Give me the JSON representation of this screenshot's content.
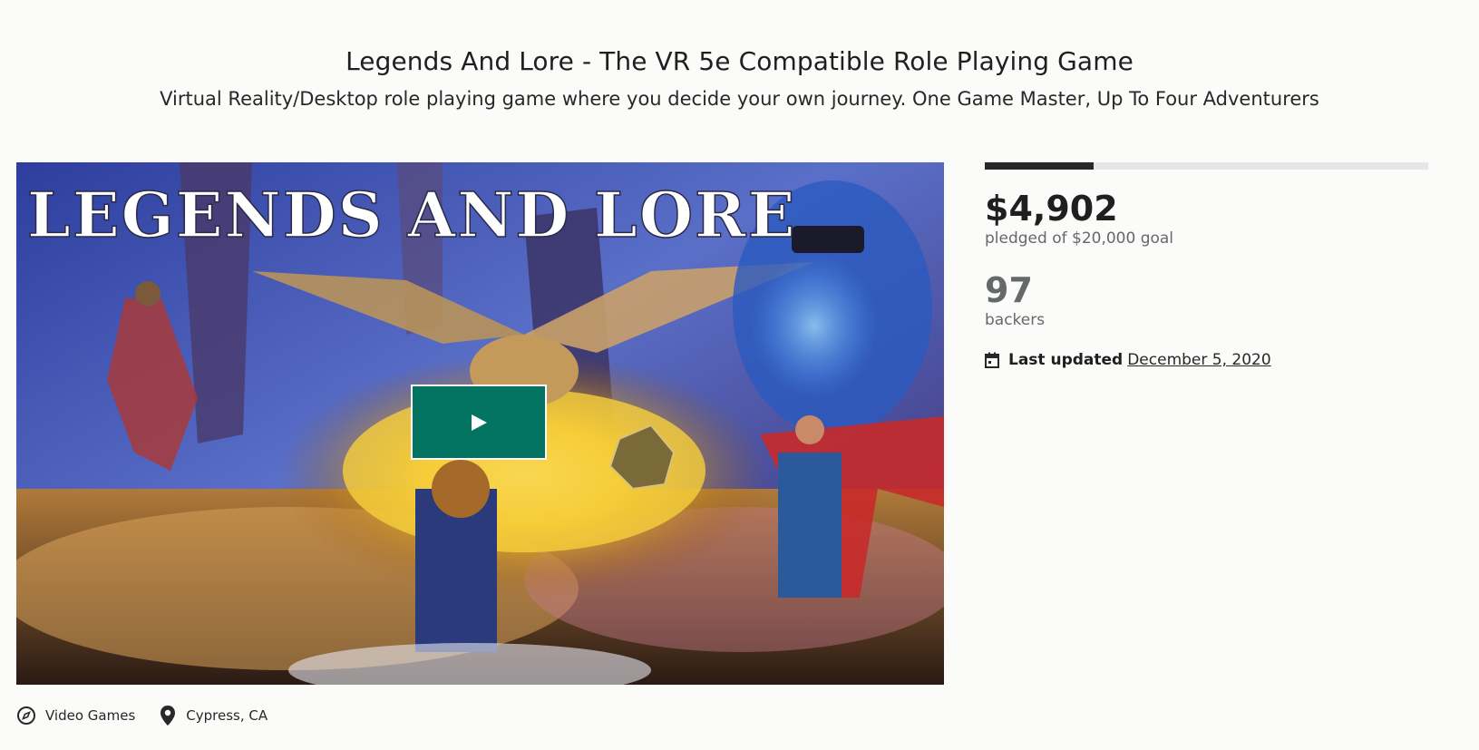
{
  "project": {
    "title": "Legends And Lore - The VR 5e Compatible Role Playing Game",
    "blurb": "Virtual Reality/Desktop role playing game where you decide your own journey. One Game Master, Up To Four Adventurers"
  },
  "media": {
    "logo_text": "LEGENDS AND LORE",
    "play_icon": "play-icon",
    "accent_color": "#037362"
  },
  "meta": {
    "category": {
      "icon": "compass-icon",
      "label": "Video Games"
    },
    "location": {
      "icon": "location-pin-icon",
      "label": "Cypress, CA"
    }
  },
  "stats": {
    "funding_progress": 0.245,
    "pledged": "$4,902",
    "pledged_goal": "pledged of $20,000 goal",
    "backers": "97",
    "backers_label": "backers",
    "updated_icon": "calendar-icon",
    "updated_label": "Last updated",
    "updated_date": "December 5, 2020"
  }
}
